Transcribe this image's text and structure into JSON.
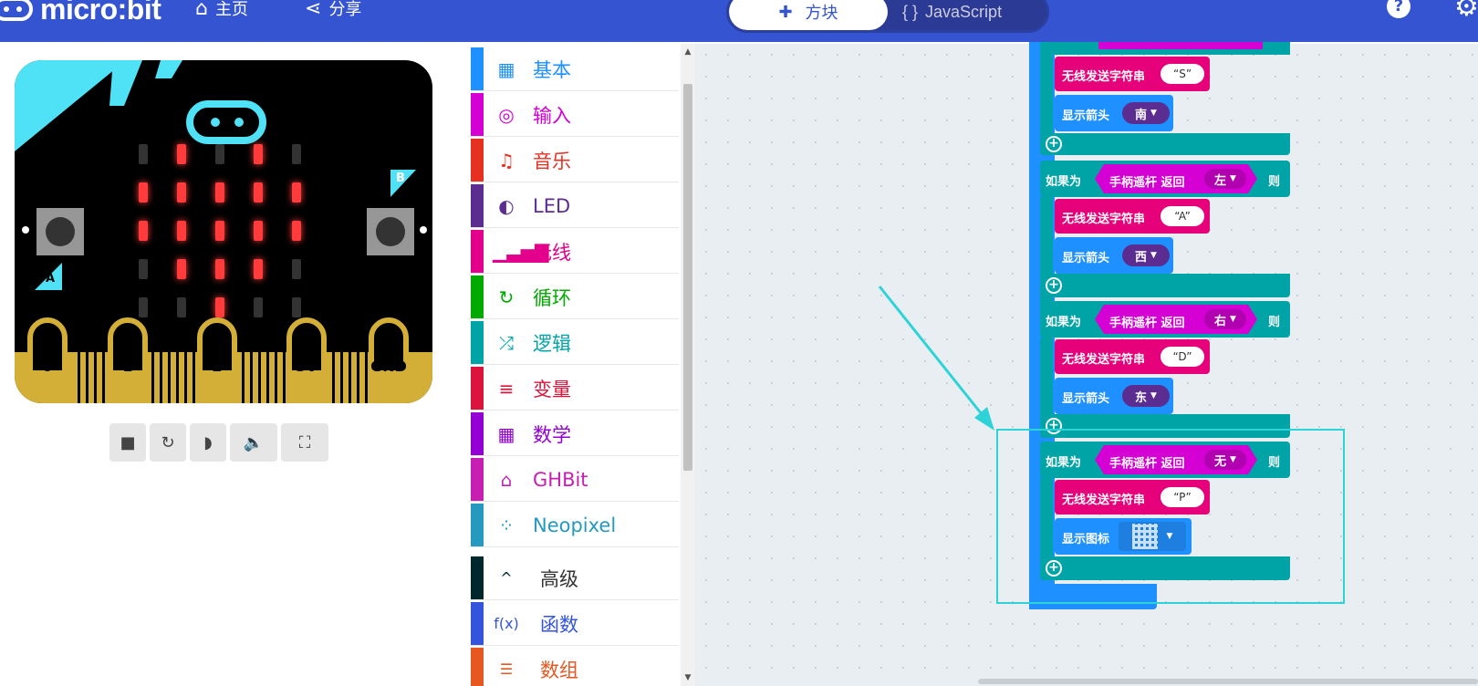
{
  "header": {
    "logo_text": "micro:bit",
    "nav": [
      {
        "label": "主页",
        "icon": "home-icon"
      },
      {
        "label": "分享",
        "icon": "share-icon"
      }
    ],
    "tabs": {
      "blocks": "方块",
      "javascript": "JavaScript"
    },
    "help_icon": "help-icon",
    "settings_icon": "gear-icon"
  },
  "simulator": {
    "pins": [
      "0",
      "1",
      "2",
      "3V",
      "GND"
    ],
    "button_a": "A",
    "button_b": "B",
    "led_matrix": [
      [
        0,
        1,
        0,
        1,
        0
      ],
      [
        1,
        1,
        1,
        1,
        1
      ],
      [
        1,
        1,
        1,
        1,
        1
      ],
      [
        0,
        1,
        1,
        1,
        0
      ],
      [
        0,
        0,
        1,
        0,
        0
      ]
    ],
    "controls": [
      "stop-icon",
      "restart-icon",
      "slowmo-icon",
      "sound-icon",
      "fullscreen-icon"
    ]
  },
  "toolbox": {
    "items": [
      {
        "label": "基本",
        "color": "#1e90ff",
        "icon": "grid-icon",
        "glyph": "▦"
      },
      {
        "label": "输入",
        "color": "#d400d4",
        "icon": "target-icon",
        "glyph": "◎"
      },
      {
        "label": "音乐",
        "color": "#e63022",
        "icon": "headphones-icon",
        "glyph": "♫"
      },
      {
        "label": "LED",
        "color": "#5c2d91",
        "icon": "toggle-icon",
        "glyph": "◐"
      },
      {
        "label": "无线",
        "color": "#e3008c",
        "icon": "signal-icon",
        "glyph": "▁▃▅▇"
      },
      {
        "label": "循环",
        "color": "#00aa00",
        "icon": "loop-icon",
        "glyph": "↻"
      },
      {
        "label": "逻辑",
        "color": "#00a4a6",
        "icon": "shuffle-icon",
        "glyph": "⤮"
      },
      {
        "label": "变量",
        "color": "#dc143c",
        "icon": "lines-icon",
        "glyph": "≡"
      },
      {
        "label": "数学",
        "color": "#9400d3",
        "icon": "calculator-icon",
        "glyph": "▦"
      },
      {
        "label": "GHBit",
        "color": "#c61fb1",
        "icon": "gamepad-icon",
        "glyph": "⌂"
      },
      {
        "label": "Neopixel",
        "color": "#2699bf",
        "icon": "dots-ring-icon",
        "glyph": "⁘"
      }
    ],
    "advanced": [
      {
        "label": "高级",
        "color": "#00272b",
        "icon": "chevron-up-icon",
        "glyph": "^"
      },
      {
        "label": "函数",
        "color": "#3455db",
        "icon": "function-icon",
        "glyph": "f(x)"
      },
      {
        "label": "数组",
        "color": "#e65722",
        "icon": "list-icon",
        "glyph": "☰"
      }
    ]
  },
  "workspace": {
    "blocks": {
      "send_string": "无线发送字符串",
      "show_arrow": "显示箭头",
      "show_icon": "显示图标",
      "if": "如果为",
      "then": "则",
      "joystick": "手柄遥杆 返回",
      "groups": [
        {
          "send": "S",
          "arrow": "南",
          "direction": "左"
        },
        {
          "send": "A",
          "arrow": "西",
          "direction": "右"
        },
        {
          "send": "D",
          "arrow": "东",
          "direction": "无"
        },
        {
          "send": "P"
        }
      ]
    },
    "colors": {
      "loop_blue": "#1e90ff",
      "logic_teal": "#00a4a6",
      "radio_pink": "#e6007a",
      "ghbit_magenta": "#d400d4",
      "arrow_purple": "#5c2d91",
      "annotation_cyan": "#2ed3d8"
    }
  }
}
